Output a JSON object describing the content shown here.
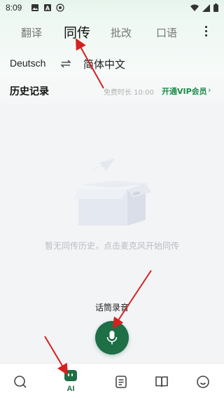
{
  "status_bar": {
    "time": "8:09",
    "left_icons": [
      "image-icon",
      "font-a-icon",
      "dev-badge-icon"
    ],
    "right_icons": [
      "wifi-icon",
      "signal-icon",
      "battery-icon"
    ]
  },
  "tabs": [
    {
      "label": "翻译",
      "active": false
    },
    {
      "label": "同传",
      "active": true
    },
    {
      "label": "批改",
      "active": false
    },
    {
      "label": "口语",
      "active": false
    }
  ],
  "more_icon": "more-vertical-icon",
  "languages": {
    "source": "Deutsch",
    "swap_icon": "swap-icon",
    "target": "简体中文"
  },
  "history": {
    "title": "历史记录",
    "free_time": "免费时长 10:00",
    "vip_link": "开通VIP会员",
    "vip_chevron": "›"
  },
  "empty_state": {
    "illustration_icon": "empty-box-icon",
    "text": "暂无同传历史，点击麦克风开始同传"
  },
  "mic": {
    "label": "话筒录音",
    "icon": "microphone-icon"
  },
  "bottom_nav": [
    {
      "icon": "search-icon",
      "label": ""
    },
    {
      "icon": "ai-icon",
      "label": "AI",
      "active": true
    },
    {
      "icon": "notes-icon",
      "label": ""
    },
    {
      "icon": "book-icon",
      "label": ""
    },
    {
      "icon": "smile-icon",
      "label": ""
    }
  ],
  "colors": {
    "accent": "#1e6f45",
    "vip": "#1d8b48",
    "annotation_arrow": "#d42020"
  }
}
